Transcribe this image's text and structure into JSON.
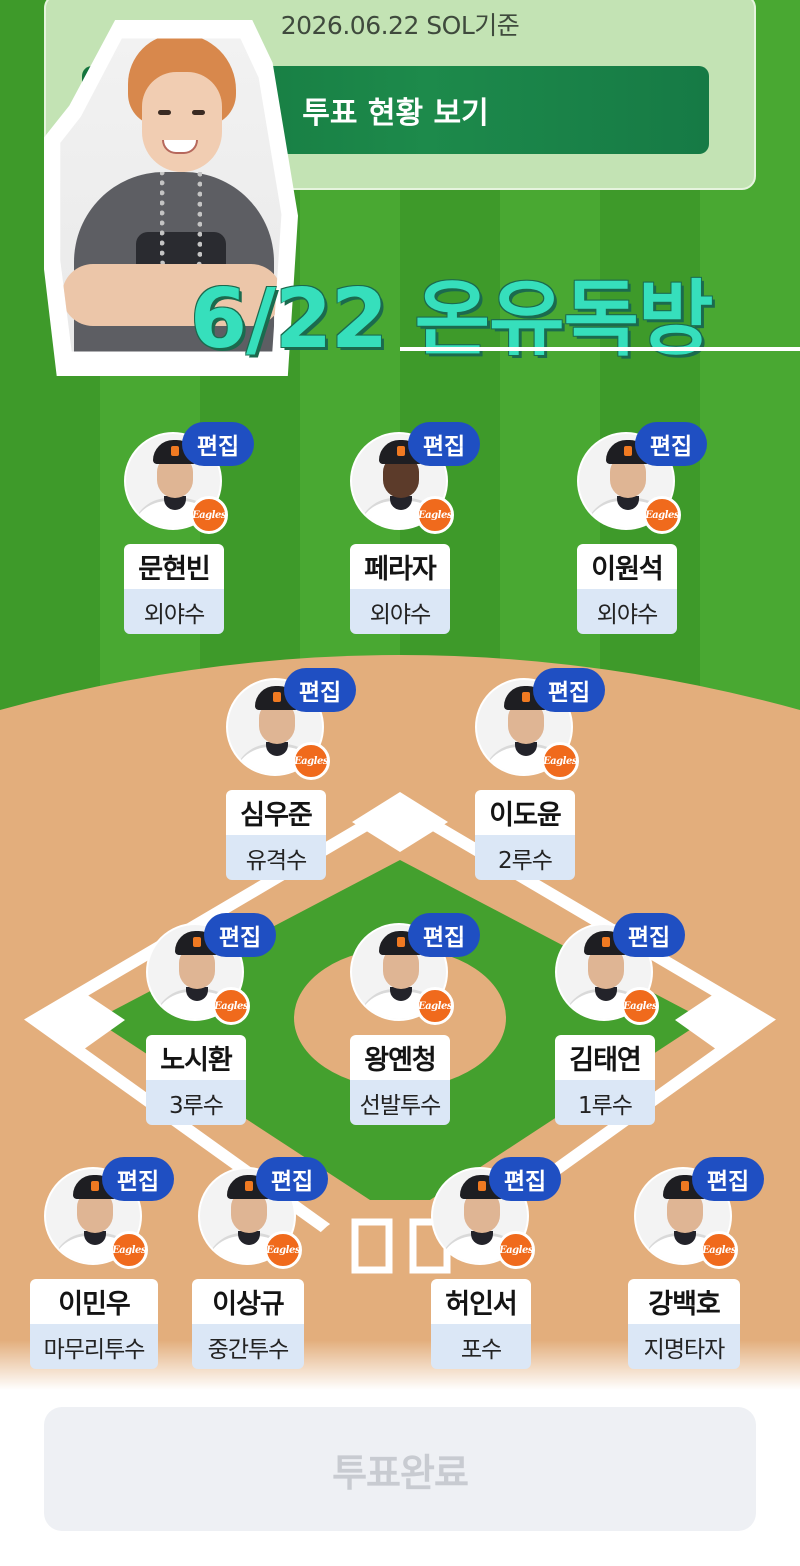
{
  "header": {
    "date_label": "2026.06.22 SOL기준",
    "vote_status_button": "투표 현황 보기"
  },
  "title": "6/22 온유독방",
  "edit_label": "편집",
  "team_logo_text": "Eagles",
  "players": [
    {
      "id": "p1",
      "name": "문현빈",
      "position": "외야수"
    },
    {
      "id": "p2",
      "name": "페라자",
      "position": "외야수"
    },
    {
      "id": "p3",
      "name": "이원석",
      "position": "외야수"
    },
    {
      "id": "p4",
      "name": "심우준",
      "position": "유격수"
    },
    {
      "id": "p5",
      "name": "이도윤",
      "position": "2루수"
    },
    {
      "id": "p6",
      "name": "노시환",
      "position": "3루수"
    },
    {
      "id": "p7",
      "name": "왕옌청",
      "position": "선발투수"
    },
    {
      "id": "p8",
      "name": "김태연",
      "position": "1루수"
    },
    {
      "id": "p9",
      "name": "이민우",
      "position": "마무리투수"
    },
    {
      "id": "p10",
      "name": "이상규",
      "position": "중간투수"
    },
    {
      "id": "p11",
      "name": "허인서",
      "position": "포수"
    },
    {
      "id": "p12",
      "name": "강백호",
      "position": "지명타자"
    }
  ],
  "done_button": "투표완료",
  "colors": {
    "grass": "#49a832",
    "dirt": "#e3ae7c",
    "edit_button": "#1f4fc2",
    "title_text": "#36dfbc",
    "team_logo": "#f06a1c",
    "vote_status_button": "#1d8a4b"
  }
}
